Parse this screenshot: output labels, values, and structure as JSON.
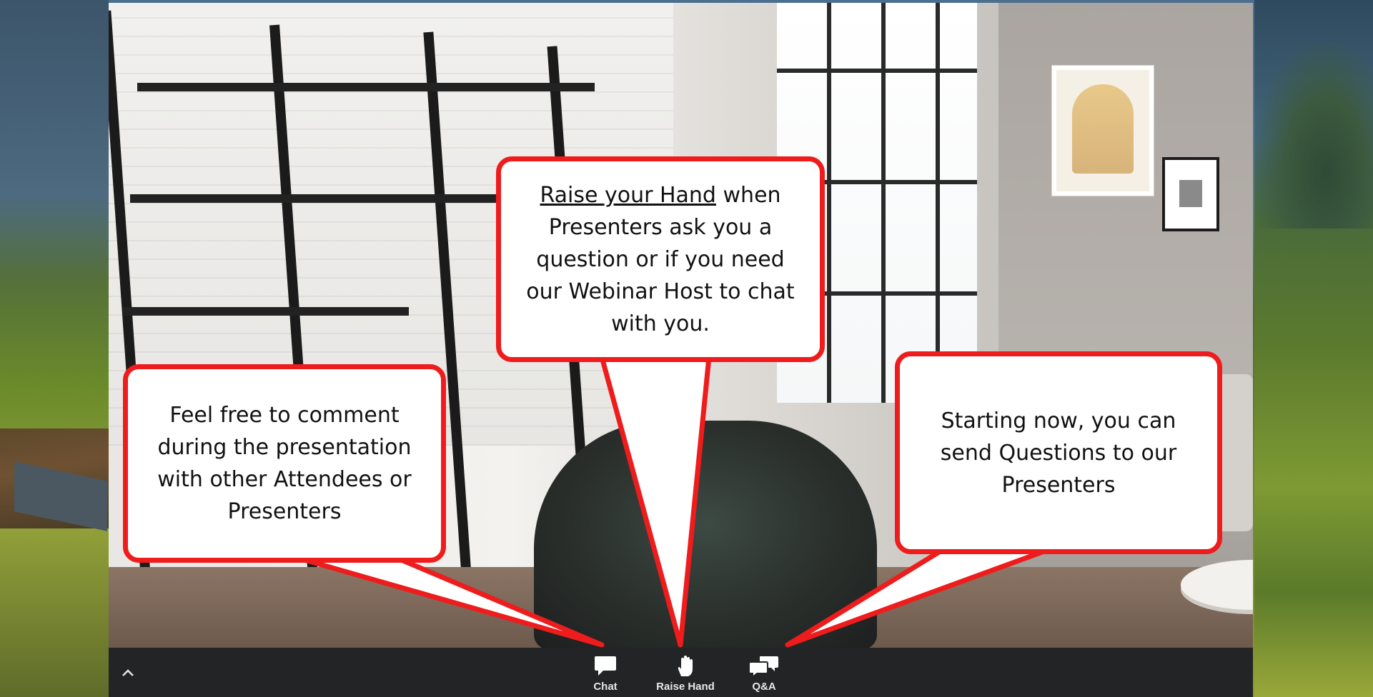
{
  "callouts": {
    "left": {
      "line1": "Feel free to comment",
      "line2": "during the presentation",
      "line3": "with other Attendees or",
      "line4": "Presenters"
    },
    "middle": {
      "underlined": "Raise your Hand",
      "line1_rest": " when",
      "line2": "Presenters ask you a",
      "line3": "question or if you need",
      "line4": "our Webinar Host to chat",
      "line5": "with you."
    },
    "right": {
      "line1": "Starting now, you can",
      "line2": "send Questions to our",
      "line3": "Presenters"
    }
  },
  "toolbar": {
    "chat_label": "Chat",
    "raise_hand_label": "Raise Hand",
    "qa_label": "Q&A"
  },
  "colors": {
    "callout_border": "#ee1c1c",
    "toolbar_bg": "#222426"
  },
  "icons": {
    "fullscreen": "fullscreen-icon",
    "collapse": "chevron-up-icon",
    "chat": "chat-bubble-icon",
    "raise_hand": "hand-icon",
    "qa": "qa-bubbles-icon"
  }
}
